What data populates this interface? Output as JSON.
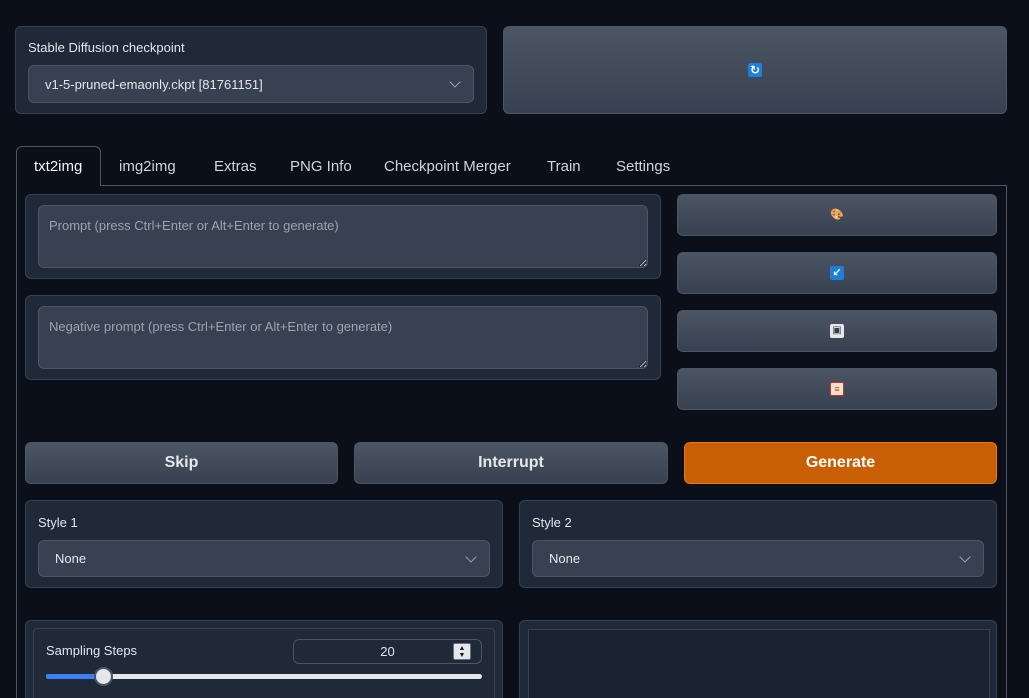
{
  "checkpoint": {
    "label": "Stable Diffusion checkpoint",
    "value": "v1-5-pruned-emaonly.ckpt [81761151]",
    "refresh_icon": "refresh-icon"
  },
  "tabs": [
    {
      "label": "txt2img",
      "active": true
    },
    {
      "label": "img2img",
      "active": false
    },
    {
      "label": "Extras",
      "active": false
    },
    {
      "label": "PNG Info",
      "active": false
    },
    {
      "label": "Checkpoint Merger",
      "active": false
    },
    {
      "label": "Train",
      "active": false
    },
    {
      "label": "Settings",
      "active": false
    }
  ],
  "prompt": {
    "placeholder": "Prompt (press Ctrl+Enter or Alt+Enter to generate)",
    "value": ""
  },
  "negative_prompt": {
    "placeholder": "Negative prompt (press Ctrl+Enter or Alt+Enter to generate)",
    "value": ""
  },
  "tool_buttons": [
    {
      "icon": "palette-icon"
    },
    {
      "icon": "arrow-down-left-icon"
    },
    {
      "icon": "floppy-disk-icon"
    },
    {
      "icon": "clipboard-icon"
    }
  ],
  "actions": {
    "skip": "Skip",
    "interrupt": "Interrupt",
    "generate": "Generate"
  },
  "styles": {
    "style1": {
      "label": "Style 1",
      "value": "None"
    },
    "style2": {
      "label": "Style 2",
      "value": "None"
    }
  },
  "sampling_steps": {
    "label": "Sampling Steps",
    "value": "20",
    "min": 1,
    "max": 150,
    "level": 0.13
  },
  "colors": {
    "accent": "#c85f05",
    "background": "#0b0f19",
    "panel": "#1f2937"
  }
}
